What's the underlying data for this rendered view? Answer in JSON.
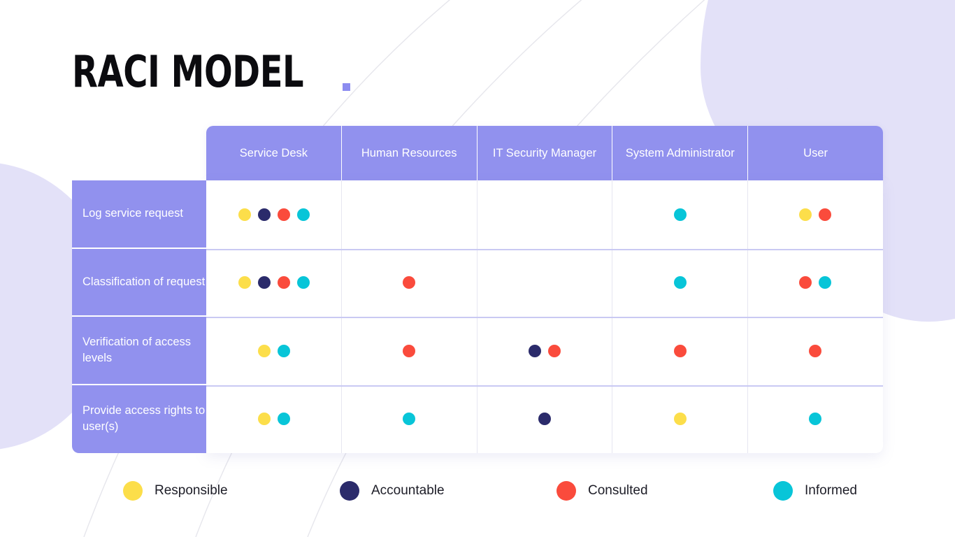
{
  "page": {
    "title": "RACI MODEL",
    "title_accent_color": "#8C8CF0"
  },
  "palette": {
    "responsible": "#FCDE4A",
    "accountable": "#2B2B6B",
    "consulted": "#FA4B3C",
    "informed": "#08C5D8",
    "header_purple": "#9191EE",
    "blob_lavender": "#E3E1F8",
    "row_divider": "#C9C9F3"
  },
  "chart_data": {
    "type": "table",
    "title": "RACI MODEL",
    "columns": [
      "Service Desk",
      "Human Resources",
      "IT Security Manager",
      "System Administrator",
      "User"
    ],
    "rows": [
      {
        "label": "Log service request",
        "cells": [
          [
            "responsible",
            "accountable",
            "consulted",
            "informed"
          ],
          [],
          [],
          [
            "informed"
          ],
          [
            "responsible",
            "consulted"
          ]
        ]
      },
      {
        "label": "Classification of request",
        "cells": [
          [
            "responsible",
            "accountable",
            "consulted",
            "informed"
          ],
          [
            "consulted"
          ],
          [],
          [
            "informed"
          ],
          [
            "consulted",
            "informed"
          ]
        ]
      },
      {
        "label": "Verification of access levels",
        "cells": [
          [
            "responsible",
            "informed"
          ],
          [
            "consulted"
          ],
          [
            "accountable",
            "consulted"
          ],
          [
            "consulted"
          ],
          [
            "consulted"
          ]
        ]
      },
      {
        "label": "Provide access rights to user(s)",
        "cells": [
          [
            "responsible",
            "informed"
          ],
          [
            "informed"
          ],
          [
            "accountable"
          ],
          [
            "responsible"
          ],
          [
            "informed"
          ]
        ]
      }
    ],
    "legend_position": "bottom"
  },
  "legend": [
    {
      "key": "responsible",
      "label": "Responsible"
    },
    {
      "key": "accountable",
      "label": "Accountable"
    },
    {
      "key": "consulted",
      "label": "Consulted"
    },
    {
      "key": "informed",
      "label": "Informed"
    }
  ]
}
